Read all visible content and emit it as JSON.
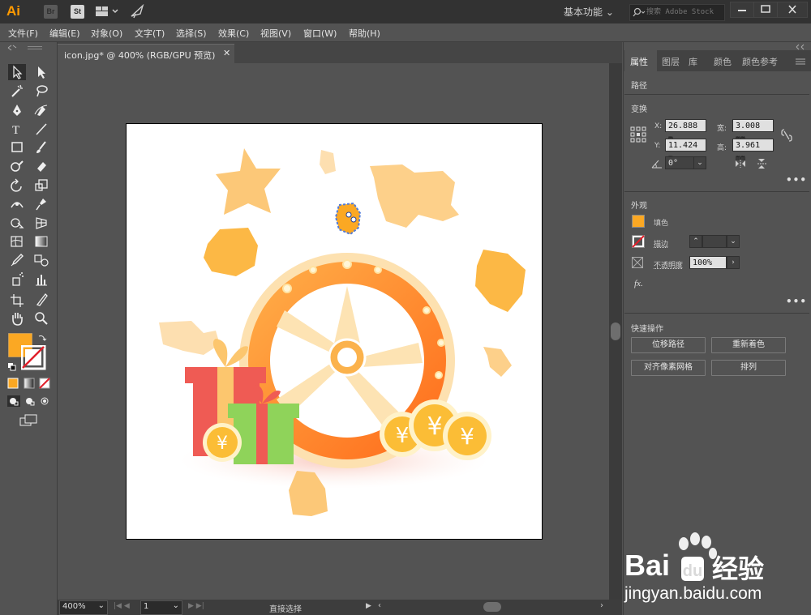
{
  "app": {
    "logo": "Ai",
    "bridge_label": "Br",
    "stock_label": "St",
    "workspace": "基本功能",
    "search_placeholder": "搜索 Adobe Stock"
  },
  "menu": [
    "文件(F)",
    "编辑(E)",
    "对象(O)",
    "文字(T)",
    "选择(S)",
    "效果(C)",
    "视图(V)",
    "窗口(W)",
    "帮助(H)"
  ],
  "document": {
    "tab_label": "icon.jpg* @ 400% (RGB/GPU 预览)",
    "close_glyph": "✕"
  },
  "status": {
    "zoom": "400%",
    "page": "1",
    "tool_text": "直接选择"
  },
  "panel": {
    "tabs": [
      "属性",
      "图层",
      "库",
      "颜色",
      "颜色参考"
    ],
    "selection_type": "路径",
    "transform": {
      "title": "变换",
      "x_label": "X:",
      "x": "26.888 m",
      "y_label": "Y:",
      "y": "11.424 m",
      "w_label": "宽:",
      "w": "3.008 mm",
      "h_label": "高:",
      "h": "3.961 mm",
      "angle": "0°"
    },
    "appearance": {
      "title": "外观",
      "fill_label": "填色",
      "stroke_label": "描边",
      "opacity_label": "不透明度",
      "opacity": "100%",
      "fx_label": "fx."
    },
    "quick_actions": {
      "title": "快速操作",
      "offset_path": "位移路径",
      "recolor": "重新着色",
      "align_pixel": "对齐像素网格",
      "arrange": "排列"
    }
  },
  "colors": {
    "fill": "#fba823",
    "accent": "#ff9a00",
    "stroke": "#ffffff"
  },
  "watermark": {
    "brand_left": "Bai",
    "brand_right": "经验",
    "url": "jingyan.baidu.com"
  }
}
